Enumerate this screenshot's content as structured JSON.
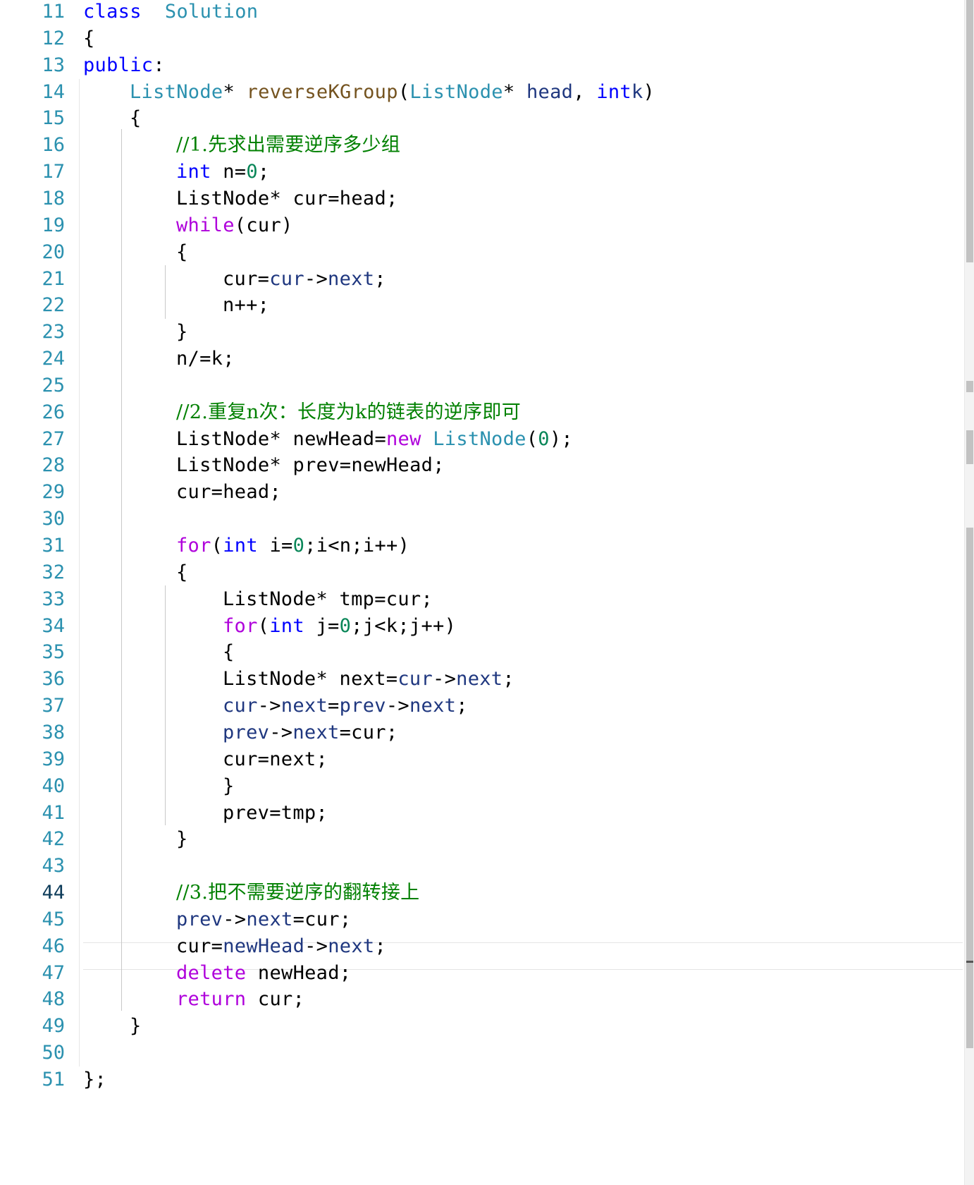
{
  "editor": {
    "active_line": "44",
    "lines": [
      {
        "num": "11",
        "indent": 0,
        "tokens": [
          [
            "kw",
            "class"
          ],
          [
            "",
            "  "
          ],
          [
            "ty",
            "Solution"
          ]
        ]
      },
      {
        "num": "12",
        "indent": 0,
        "tokens": [
          [
            "",
            "{"
          ]
        ]
      },
      {
        "num": "13",
        "indent": 0,
        "tokens": [
          [
            "kw",
            "public"
          ],
          [
            "",
            ":"
          ]
        ]
      },
      {
        "num": "14",
        "indent": 1,
        "tokens": [
          [
            "ty",
            "ListNode"
          ],
          [
            "",
            "* "
          ],
          [
            "fn",
            "reverseKGroup"
          ],
          [
            "",
            "("
          ],
          [
            "ty",
            "ListNode"
          ],
          [
            "",
            "* "
          ],
          [
            "var",
            "head"
          ],
          [
            "",
            ", "
          ],
          [
            "kw",
            "int"
          ],
          [
            "",
            "",
            " "
          ],
          [
            "var",
            "k"
          ],
          [
            "",
            ")"
          ]
        ]
      },
      {
        "num": "15",
        "indent": 1,
        "tokens": [
          [
            "",
            "{"
          ]
        ]
      },
      {
        "num": "16",
        "indent": 2,
        "tokens": [
          [
            "cmt",
            "//1.先求出需要逆序多少组"
          ]
        ]
      },
      {
        "num": "17",
        "indent": 2,
        "tokens": [
          [
            "kw",
            "int"
          ],
          [
            "",
            " n="
          ],
          [
            "num",
            "0"
          ],
          [
            "",
            ";"
          ]
        ]
      },
      {
        "num": "18",
        "indent": 2,
        "tokens": [
          [
            "",
            "ListNode* cur=head;"
          ]
        ]
      },
      {
        "num": "19",
        "indent": 2,
        "tokens": [
          [
            "ctl",
            "while"
          ],
          [
            "",
            "(cur)"
          ]
        ]
      },
      {
        "num": "20",
        "indent": 2,
        "tokens": [
          [
            "",
            "{"
          ]
        ]
      },
      {
        "num": "21",
        "indent": 3,
        "tokens": [
          [
            "",
            "cur="
          ],
          [
            "var",
            "cur"
          ],
          [
            "",
            "->"
          ],
          [
            "mem",
            "next"
          ],
          [
            "",
            ";"
          ]
        ]
      },
      {
        "num": "22",
        "indent": 3,
        "tokens": [
          [
            "",
            "n++;"
          ]
        ]
      },
      {
        "num": "23",
        "indent": 2,
        "tokens": [
          [
            "",
            "}"
          ]
        ]
      },
      {
        "num": "24",
        "indent": 2,
        "tokens": [
          [
            "",
            "n/=k;"
          ]
        ]
      },
      {
        "num": "25",
        "indent": 0,
        "tokens": []
      },
      {
        "num": "26",
        "indent": 2,
        "tokens": [
          [
            "cmt",
            "//2.重复n次：长度为k的链表的逆序即可"
          ]
        ]
      },
      {
        "num": "27",
        "indent": 2,
        "tokens": [
          [
            "",
            "ListNode* newHead="
          ],
          [
            "ctl",
            "new"
          ],
          [
            "",
            " "
          ],
          [
            "ty",
            "ListNode"
          ],
          [
            "",
            "("
          ],
          [
            "num",
            "0"
          ],
          [
            "",
            ");"
          ]
        ]
      },
      {
        "num": "28",
        "indent": 2,
        "tokens": [
          [
            "",
            "ListNode* prev=newHead;"
          ]
        ]
      },
      {
        "num": "29",
        "indent": 2,
        "tokens": [
          [
            "",
            "cur=head;"
          ]
        ]
      },
      {
        "num": "30",
        "indent": 0,
        "tokens": []
      },
      {
        "num": "31",
        "indent": 2,
        "tokens": [
          [
            "ctl",
            "for"
          ],
          [
            "",
            "("
          ],
          [
            "kw",
            "int"
          ],
          [
            "",
            " i="
          ],
          [
            "num",
            "0"
          ],
          [
            "",
            ";i<n;i++)"
          ]
        ]
      },
      {
        "num": "32",
        "indent": 2,
        "tokens": [
          [
            "",
            "{"
          ]
        ]
      },
      {
        "num": "33",
        "indent": 3,
        "tokens": [
          [
            "",
            "ListNode* tmp=cur;"
          ]
        ]
      },
      {
        "num": "34",
        "indent": 3,
        "tokens": [
          [
            "ctl",
            "for"
          ],
          [
            "",
            "("
          ],
          [
            "kw",
            "int"
          ],
          [
            "",
            " j="
          ],
          [
            "num",
            "0"
          ],
          [
            "",
            ";j<k;j++)"
          ]
        ]
      },
      {
        "num": "35",
        "indent": 3,
        "tokens": [
          [
            "",
            "{"
          ]
        ]
      },
      {
        "num": "36",
        "indent": 3,
        "tokens": [
          [
            "",
            "ListNode* next="
          ],
          [
            "var",
            "cur"
          ],
          [
            "",
            "->"
          ],
          [
            "mem",
            "next"
          ],
          [
            "",
            ";"
          ]
        ]
      },
      {
        "num": "37",
        "indent": 3,
        "tokens": [
          [
            "var",
            "cur"
          ],
          [
            "",
            "->"
          ],
          [
            "mem",
            "next"
          ],
          [
            "",
            "="
          ],
          [
            "var",
            "prev"
          ],
          [
            "",
            "->"
          ],
          [
            "mem",
            "next"
          ],
          [
            "",
            ";"
          ]
        ]
      },
      {
        "num": "38",
        "indent": 3,
        "tokens": [
          [
            "var",
            "prev"
          ],
          [
            "",
            "->"
          ],
          [
            "mem",
            "next"
          ],
          [
            "",
            "=cur;"
          ]
        ]
      },
      {
        "num": "39",
        "indent": 3,
        "tokens": [
          [
            "",
            "cur=next;"
          ]
        ]
      },
      {
        "num": "40",
        "indent": 3,
        "tokens": [
          [
            "",
            "}"
          ]
        ]
      },
      {
        "num": "41",
        "indent": 3,
        "tokens": [
          [
            "",
            "prev=tmp;"
          ]
        ]
      },
      {
        "num": "42",
        "indent": 2,
        "tokens": [
          [
            "",
            "}"
          ]
        ]
      },
      {
        "num": "43",
        "indent": 0,
        "tokens": []
      },
      {
        "num": "44",
        "indent": 2,
        "tokens": [
          [
            "cmt",
            "//3.把不需要逆序的翻转接上"
          ]
        ]
      },
      {
        "num": "45",
        "indent": 2,
        "tokens": [
          [
            "var",
            "prev"
          ],
          [
            "",
            "->"
          ],
          [
            "mem",
            "next"
          ],
          [
            "",
            "=cur;"
          ]
        ]
      },
      {
        "num": "46",
        "indent": 2,
        "tokens": [
          [
            "",
            "cur="
          ],
          [
            "var",
            "newHead"
          ],
          [
            "",
            "->"
          ],
          [
            "mem",
            "next"
          ],
          [
            "",
            ";"
          ]
        ]
      },
      {
        "num": "47",
        "indent": 2,
        "tokens": [
          [
            "ctl",
            "delete"
          ],
          [
            "",
            " newHead;"
          ]
        ]
      },
      {
        "num": "48",
        "indent": 2,
        "tokens": [
          [
            "ctl",
            "return"
          ],
          [
            "",
            " cur;"
          ]
        ]
      },
      {
        "num": "49",
        "indent": 1,
        "tokens": [
          [
            "",
            "}"
          ]
        ]
      },
      {
        "num": "50",
        "indent": 0,
        "tokens": []
      },
      {
        "num": "51",
        "indent": 0,
        "tokens": [
          [
            "",
            "};"
          ]
        ]
      }
    ]
  }
}
